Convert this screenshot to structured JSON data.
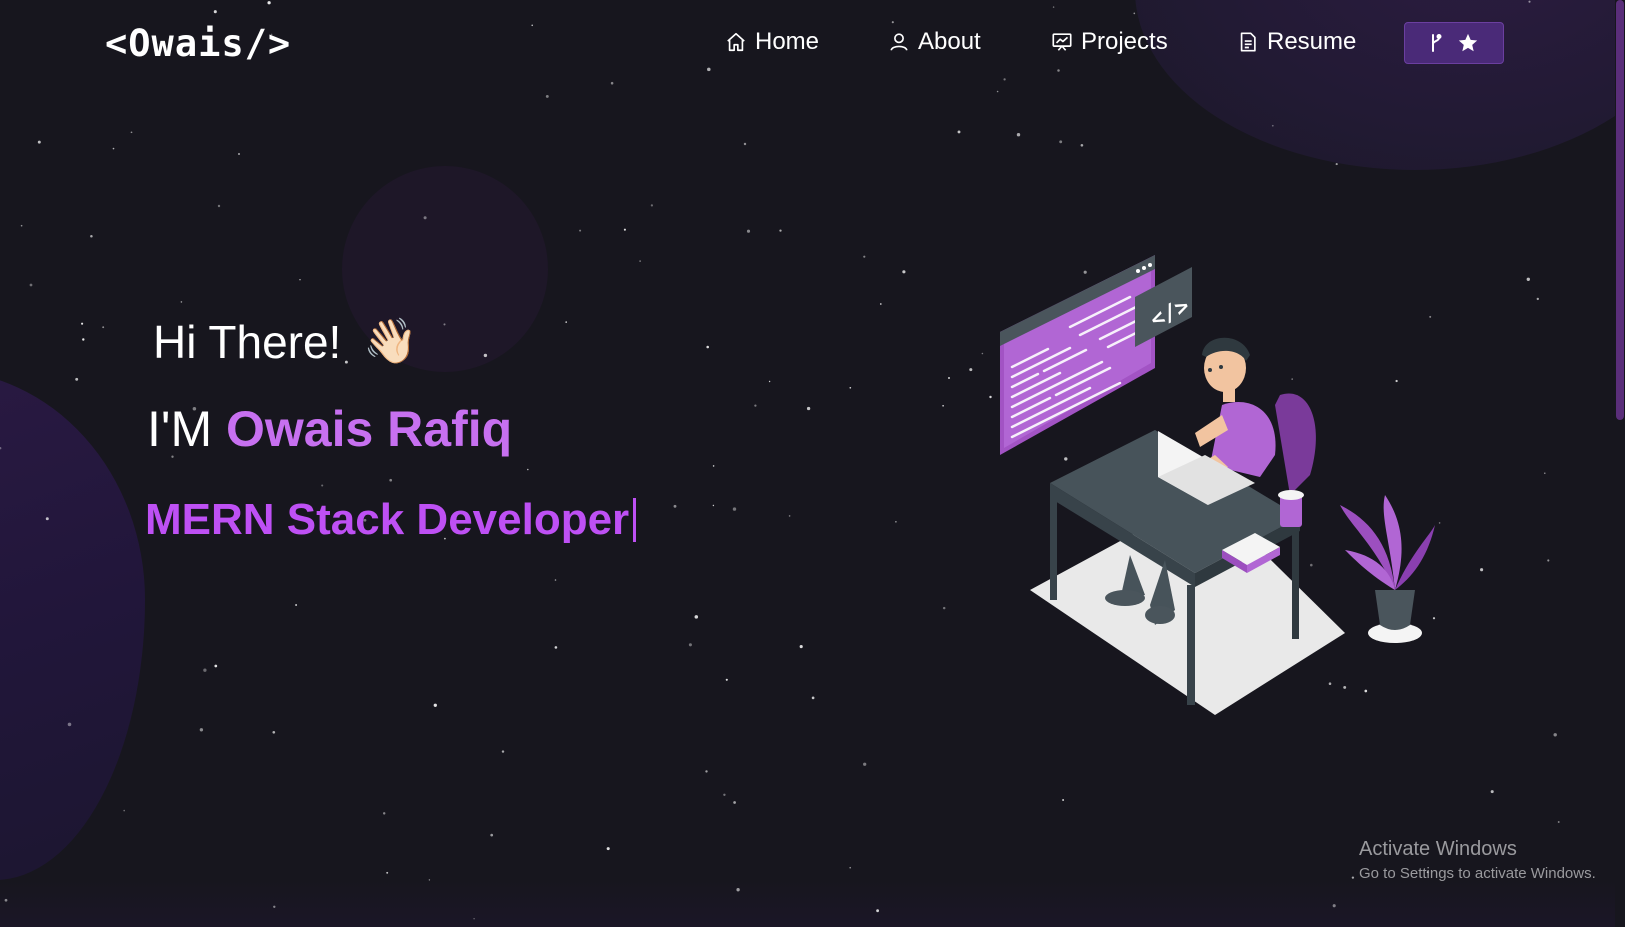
{
  "brand": {
    "logo_text": "<Owais/>"
  },
  "nav": {
    "items": [
      {
        "label": "Home",
        "icon": "home-icon"
      },
      {
        "label": "About",
        "icon": "user-icon"
      },
      {
        "label": "Projects",
        "icon": "presentation-icon"
      },
      {
        "label": "Resume",
        "icon": "document-icon"
      }
    ],
    "fork_button": {
      "icons": [
        "git-fork-icon",
        "star-icon"
      ]
    }
  },
  "hero": {
    "greeting": "Hi There!",
    "greeting_emoji": "👋🏻",
    "intro_prefix": "I'M",
    "name": "Owais Rafiq",
    "role": "MERN Stack Developer"
  },
  "watermark": {
    "title": "Activate Windows",
    "subtitle": "Go to Settings to activate Windows."
  },
  "colors": {
    "background": "#17161e",
    "accent": "#c770f0",
    "role_text": "#be50f4",
    "button_bg": "#4a2a78"
  }
}
